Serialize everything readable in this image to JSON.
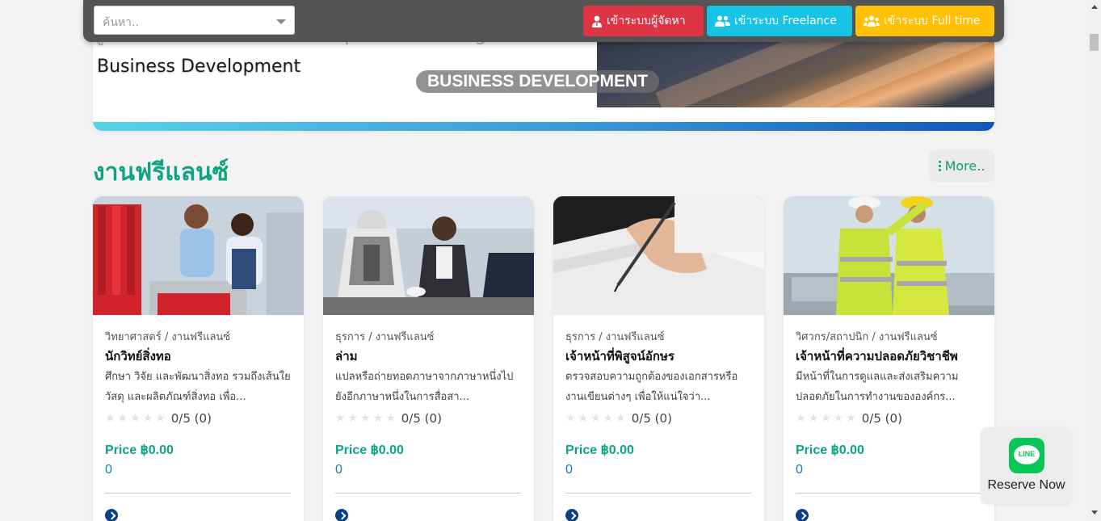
{
  "banner": {
    "faded_text": "ผู้จัดการ Business Development Manager หรือ Director of",
    "heading": "Business Development",
    "chip": "BUSINESS DEVELOPMENT"
  },
  "topbar": {
    "search_placeholder": "ค้นหา..",
    "btn_admin": "เข้าระบบผู้จัดหา",
    "btn_freelance": "เข้าระบบ Freelance",
    "btn_fulltime": "เข้าระบบ Full time"
  },
  "section": {
    "title": "งานฟรีแลนซ์",
    "more_label": "More.."
  },
  "cards": [
    {
      "category": "วิทยาศาสตร์ / งานฟรีแลนซ์",
      "title": "นักวิทย์สิ่งทอ",
      "desc": "ศึกษา วิจัย และพัฒนาสิ่งทอ รวมถึงเส้นใย วัสดุ และผลิตภัณฑ์สิ่งทอ เพื่อ...",
      "rating": "0/5 (0)",
      "price": "Price ฿0.00",
      "count": "0"
    },
    {
      "category": "ธุรการ / งานฟรีแลนซ์",
      "title": "ล่าม",
      "desc": "แปลหรือถ่ายทอดภาษาจากภาษาหนึ่งไปยังอีกภาษาหนึ่งในการสื่อสา...",
      "rating": "0/5 (0)",
      "price": "Price ฿0.00",
      "count": "0"
    },
    {
      "category": "ธุรการ / งานฟรีแลนซ์",
      "title": "เจ้าหน้าที่พิสูจน์อักษร",
      "desc": "ตรวจสอบความถูกต้องของเอกสารหรืองานเขียนต่างๆ เพื่อให้แน่ใจว่า...",
      "rating": "0/5 (0)",
      "price": "Price ฿0.00",
      "count": "0"
    },
    {
      "category": "วิศวกร/สถาปนิก / งานฟรีแลนซ์",
      "title": "เจ้าหน้าที่ความปลอดภัยวิชาชีพ",
      "desc": "มีหน้าที่ในการดูแลและส่งเสริมความปลอดภัยในการทำงานขององค์กร...",
      "rating": "0/5 (0)",
      "price": "Price ฿0.00",
      "count": "0"
    }
  ],
  "reserve": {
    "icon_text": "LINE",
    "label": "Reserve Now"
  },
  "colors": {
    "accent": "#0fa37f",
    "admin_btn": "#dc3545",
    "freelance_btn": "#17c4e6",
    "fulltime_btn": "#ffc107",
    "line_green": "#06c755"
  }
}
